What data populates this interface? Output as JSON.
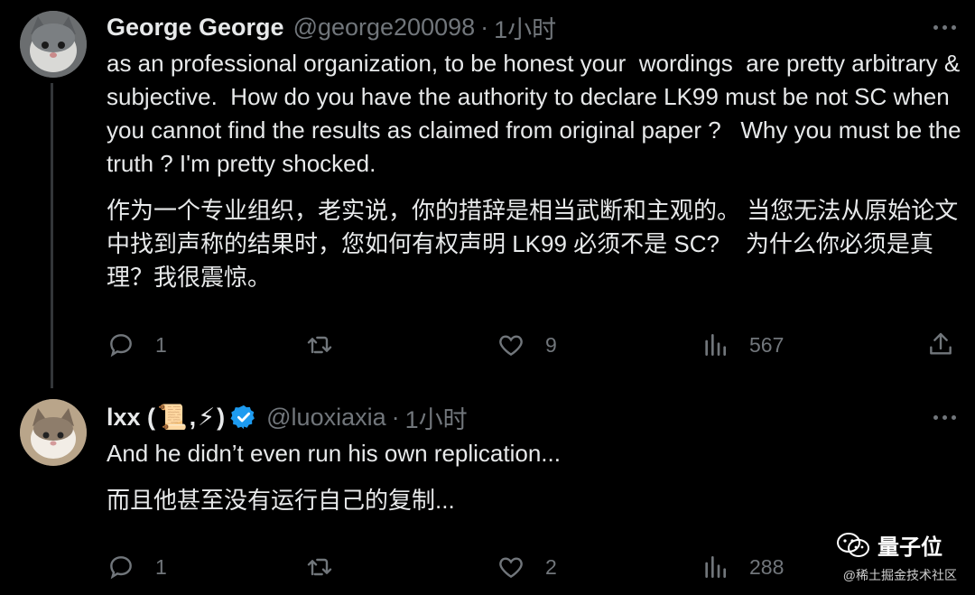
{
  "tweets": [
    {
      "name": "George George",
      "handle": "@george200098",
      "separator": "·",
      "time": "1小时",
      "text_en": "as an professional organization, to be honest your  wordings  are pretty arbitrary & subjective.  How do you have the authority to declare LK99 must be not SC when you cannot find the results as claimed from original paper ?   Why you must be the truth ? I'm pretty shocked.",
      "text_zh": "作为一个专业组织，老实说，你的措辞是相当武断和主观的。 当您无法从原始论文中找到声称的结果时，您如何有权声明 LK99 必须不是 SC?    为什么你必须是真理？我很震惊。",
      "replies": "1",
      "retweets": "",
      "likes": "9",
      "views": "567"
    },
    {
      "name_prefix": "lxx (",
      "name_sep": ",",
      "name_suffix": ")",
      "emoji1": "📜",
      "emoji2": "⚡",
      "handle": "@luoxiaxia",
      "separator": "·",
      "time": "1小时",
      "text_en": "And he didn’t even run his own replication...",
      "text_zh": "而且他甚至没有运行自己的复制...",
      "replies": "1",
      "retweets": "",
      "likes": "2",
      "views": "288"
    }
  ],
  "watermark": {
    "brand": "量子位",
    "source": "@稀土掘金技术社区"
  },
  "icons": {
    "reply": "reply-icon",
    "retweet": "retweet-icon",
    "like": "heart-icon",
    "views": "views-icon",
    "share": "share-icon",
    "more": "more-icon",
    "verified": "verified-badge-icon"
  },
  "colors": {
    "background": "#000000",
    "text": "#e7e9ea",
    "muted": "#71767b",
    "verified": "#1d9bf0"
  }
}
